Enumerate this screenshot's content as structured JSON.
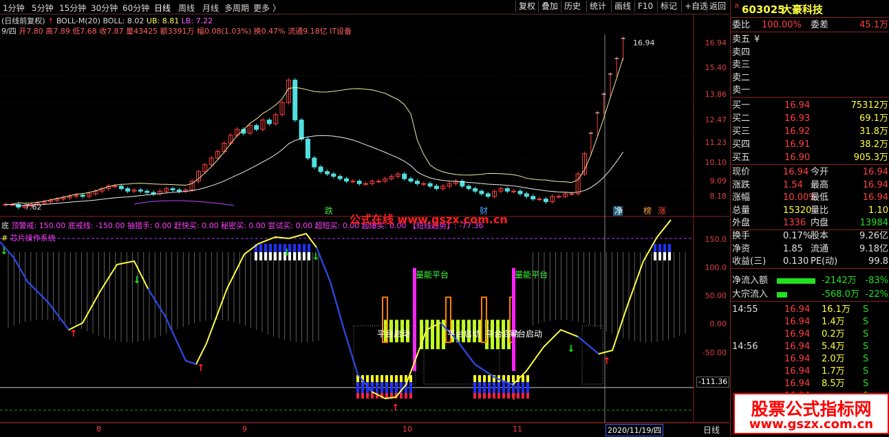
{
  "toolbar": {
    "periods": [
      "1分钟",
      "5分钟",
      "15分钟",
      "30分钟",
      "60分钟",
      "日线",
      "周线",
      "月线",
      "多周期",
      "更多 〉"
    ],
    "buttons": [
      "复权",
      "叠加",
      "历史",
      "统计",
      "画线",
      "F10",
      "标记",
      "+自选",
      "返回"
    ]
  },
  "info": {
    "chart_title": "(日线前复权)",
    "indicator": "BOLL-M(20)",
    "boll": "BOLL: 8.02",
    "ub": "UB: 8.81",
    "lb": "LB: 7.22",
    "date": "9/四",
    "ohlc": "开7.80 高7.89 低7.68 收7.87 量43425 额3391万 幅0.08(1.03%) 换0.47% 流通9.18亿 IT设备"
  },
  "price_axis": [
    "16.94",
    "15.40",
    "13.86",
    "12.47",
    "11.23",
    "10.10",
    "9.09",
    "8.18"
  ],
  "price_marks": {
    "high": "16.94",
    "low": "7.62"
  },
  "price_tags": [
    "跌",
    "财",
    "净",
    "榜",
    "涨"
  ],
  "indicator_line": "顶警戒: 150.00  底戒线: -150.00    抽猎手: 0.00   赶快买: 0.00  秘密买: 0.00  尝试买: 0.00   超短买: 0.00   超爆买: 0.00   【短线趋势】: -77.36",
  "indicator_label": "芯片操作系统",
  "indicator_axis": [
    "150.0",
    "100.0",
    "50.00",
    "0.00",
    "-50.00"
  ],
  "indicator_value": "-111.36",
  "annotations": [
    "量能平台",
    "量能平台",
    "平台启动",
    "平台启动",
    "平台启动",
    "平台启动"
  ],
  "watermark_center": "公式在线 www.gszx.com.cn",
  "watermark_corner": {
    "title": "股票公式指标网",
    "url": "www.gszx.com.cn"
  },
  "xaxis": [
    "8",
    "9",
    "10",
    "11"
  ],
  "cursor_date": "2020/11/19/四",
  "bottom_tab": "日线",
  "stock": {
    "code": "603025",
    "name": "大豪科技"
  },
  "depth": {
    "ratio_label": "委比",
    "ratio": "100.00%",
    "diff_label": "委差",
    "diff": "45.1万",
    "asks": [
      {
        "l": "卖五",
        "p": "",
        "v": "¥"
      },
      {
        "l": "卖四",
        "p": "",
        "v": ""
      },
      {
        "l": "卖三",
        "p": "",
        "v": ""
      },
      {
        "l": "卖二",
        "p": "",
        "v": ""
      },
      {
        "l": "卖一",
        "p": "",
        "v": ""
      }
    ],
    "bids": [
      {
        "l": "买一",
        "p": "16.94",
        "v": "75312万"
      },
      {
        "l": "买二",
        "p": "16.93",
        "v": "69.1万"
      },
      {
        "l": "买三",
        "p": "16.92",
        "v": "31.8万"
      },
      {
        "l": "买四",
        "p": "16.91",
        "v": "38.2万"
      },
      {
        "l": "买五",
        "p": "16.90",
        "v": "905.3万"
      }
    ]
  },
  "quote": [
    {
      "a": "现价",
      "b": "16.94",
      "c": "今开",
      "d": "16.94"
    },
    {
      "a": "涨跌",
      "b": "1.54",
      "c": "最高",
      "d": "16.94"
    },
    {
      "a": "涨幅",
      "b": "10.00%",
      "c": "最低",
      "d": "16.94"
    },
    {
      "a": "总量",
      "b": "15320",
      "c": "量比",
      "d": "1.10"
    },
    {
      "a": "外盘",
      "b": "1336",
      "c": "内盘",
      "d": "13984"
    },
    {
      "a": "换手",
      "b": "0.17%",
      "c": "股本",
      "d": "9.26亿"
    },
    {
      "a": "净资",
      "b": "1.85",
      "c": "流通",
      "d": "9.18亿"
    },
    {
      "a": "收益(三)",
      "b": "0.130",
      "c": "PE(动)",
      "d": "99.8"
    }
  ],
  "flows": [
    {
      "l": "净流入额",
      "v": "-2142万",
      "p": "-83%"
    },
    {
      "l": "大宗流入",
      "v": "-568.0万",
      "p": "-22%"
    }
  ],
  "ticks": [
    {
      "t": "14:55",
      "p": "16.94",
      "v": "16.1万",
      "s": "S"
    },
    {
      "t": "",
      "p": "16.94",
      "v": "1.4万",
      "s": "S"
    },
    {
      "t": "",
      "p": "16.94",
      "v": "0.2万",
      "s": "S"
    },
    {
      "t": "14:56",
      "p": "16.94",
      "v": "5.4万",
      "s": "S"
    },
    {
      "t": "",
      "p": "16.94",
      "v": "2.0万",
      "s": "S"
    },
    {
      "t": "",
      "p": "16.94",
      "v": "1.7万",
      "s": "S"
    },
    {
      "t": "",
      "p": "16.94",
      "v": "8.5万",
      "s": "S"
    },
    {
      "t": "",
      "p": "16.94",
      "v": "",
      "s": "S"
    }
  ]
}
